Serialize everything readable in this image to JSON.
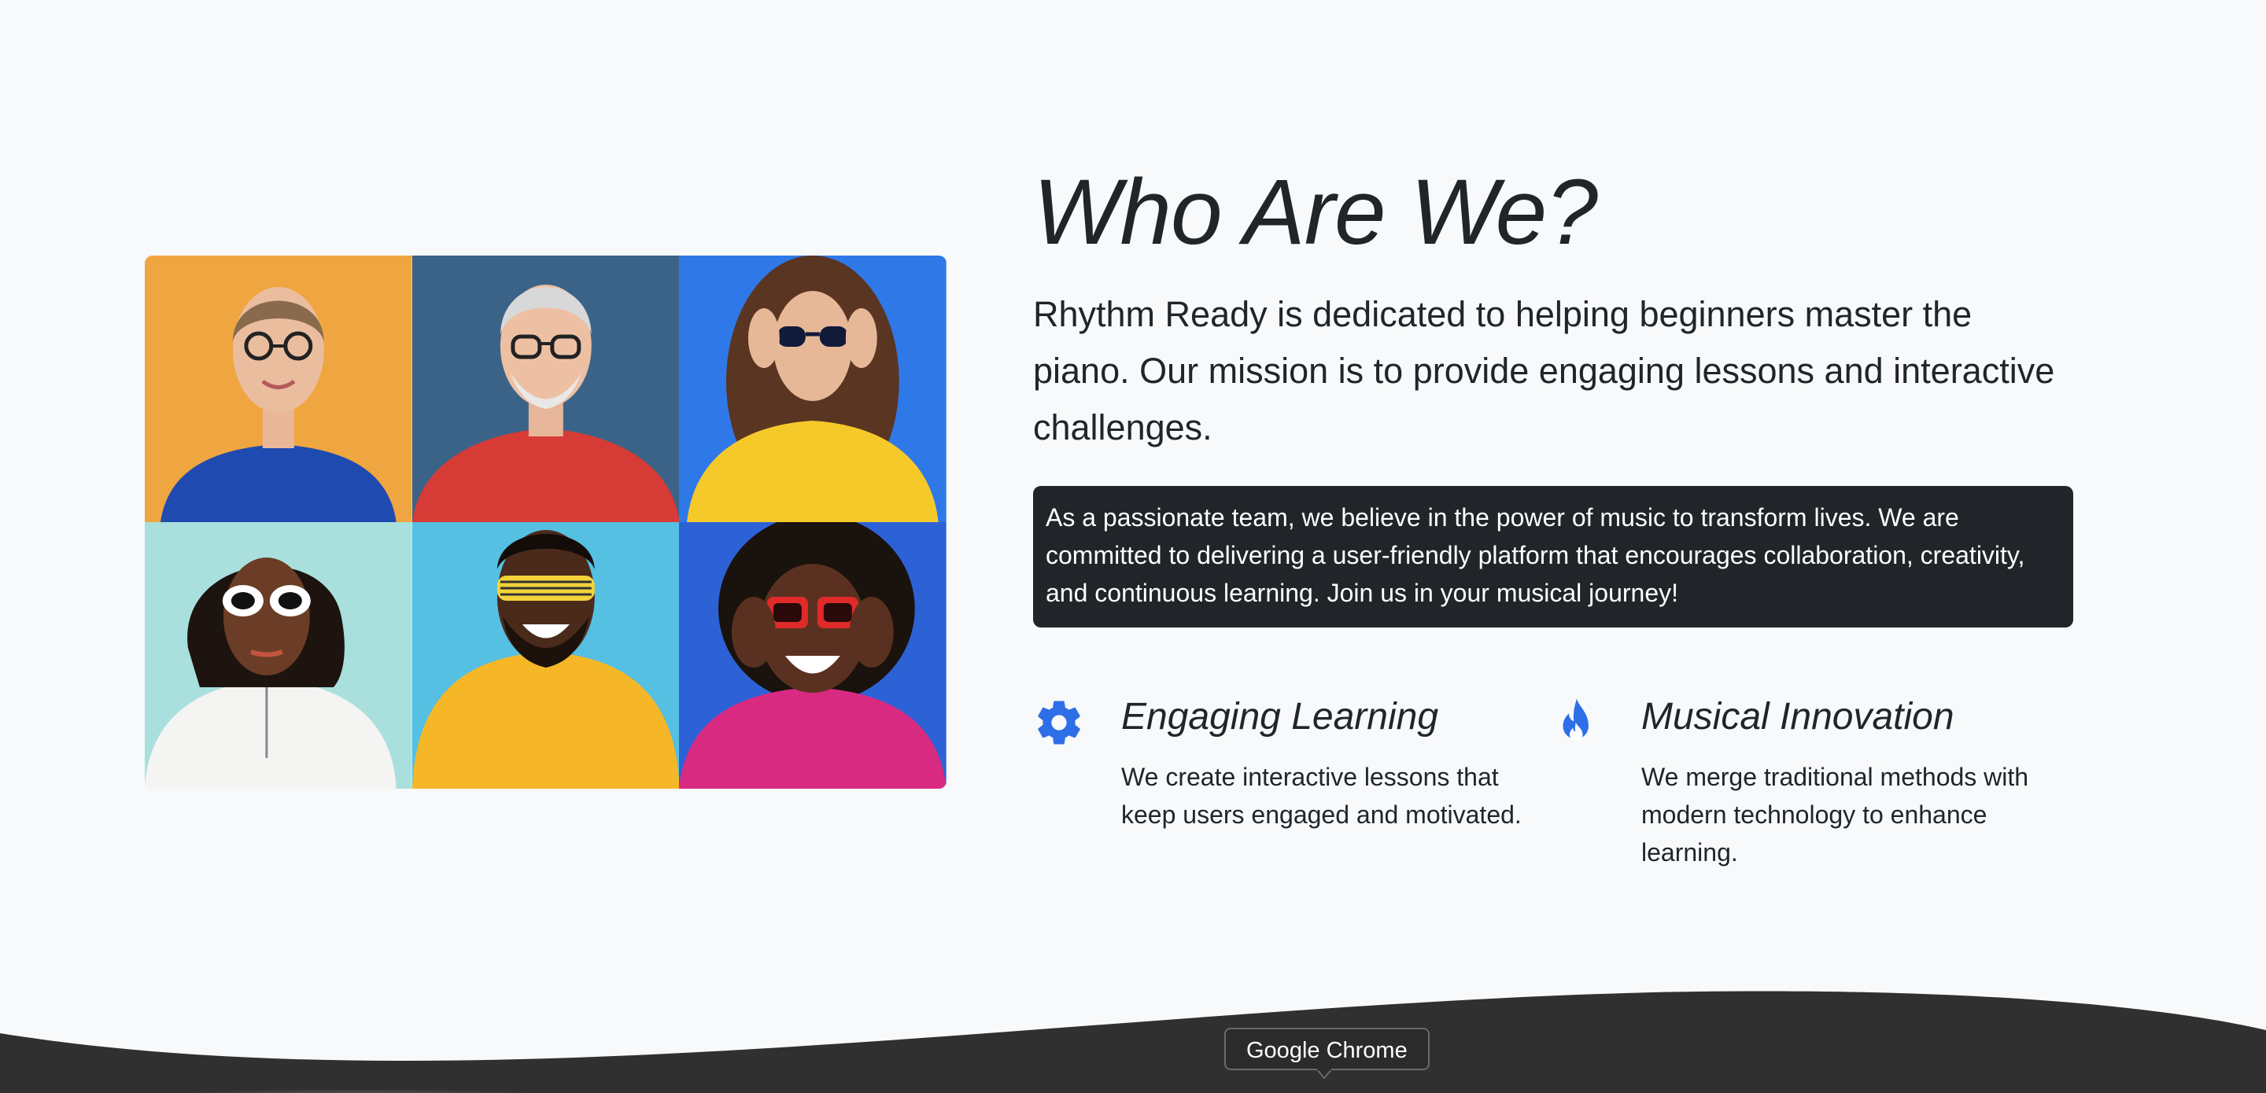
{
  "about": {
    "title": "Who Are We?",
    "lead_brand": "Rhythm Ready",
    "lead_text": " is dedicated to helping beginners master the piano. Our mission is to provide engaging lessons and interactive challenges.",
    "card_text": "As a passionate team, we believe in the power of music to transform lives. We are committed to delivering a user-friendly platform that encourages collaboration, creativity, and continuous learning. Join us in your musical journey!"
  },
  "features": [
    {
      "icon": "gear-icon",
      "title": "Engaging Learning",
      "text": "We create interactive lessons that keep users engaged and motivated."
    },
    {
      "icon": "fire-icon",
      "title": "Musical Innovation",
      "text": "We merge traditional methods with modern technology to enhance learning."
    }
  ],
  "collage": {
    "tiles": [
      {
        "background": "#f0a640"
      },
      {
        "background": "#3b6388"
      },
      {
        "background": "#2f78e8"
      },
      {
        "background": "#a9e0dd"
      },
      {
        "background": "#55c0e2"
      },
      {
        "background": "#2d62d6"
      }
    ]
  },
  "dock": {
    "tooltip": "Google Chrome"
  },
  "colors": {
    "accent": "#2e6fe8",
    "page_background": "#f8f9fa",
    "card_background": "#212529",
    "dock_background": "#303030"
  }
}
